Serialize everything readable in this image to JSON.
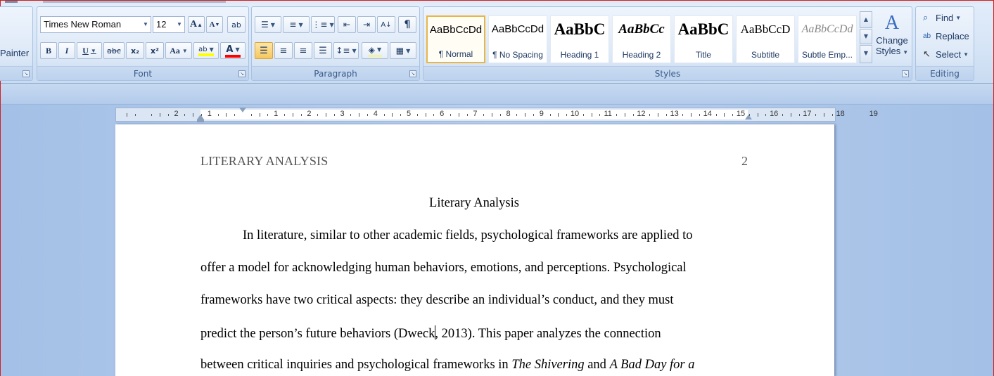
{
  "clipboard": {
    "painter_label": "Painter"
  },
  "font": {
    "group_label": "Font",
    "face": "Times New Roman",
    "size": "12",
    "buttons": {
      "grow": "A",
      "shrink": "A",
      "clear": "ab",
      "bold": "B",
      "italic": "I",
      "underline": "U",
      "strike": "abc",
      "subscript": "x₂",
      "superscript": "x²",
      "case": "Aa",
      "highlight": "ab",
      "font_color": "A"
    },
    "colors": {
      "highlight": "#ffff00",
      "font_color": "#ff0000"
    }
  },
  "paragraph": {
    "group_label": "Paragraph"
  },
  "styles": {
    "group_label": "Styles",
    "tiles": [
      {
        "sample": "AaBbCcDd",
        "name": "¶ Normal"
      },
      {
        "sample": "AaBbCcDd",
        "name": "¶ No Spacing"
      },
      {
        "sample": "AaBbC",
        "name": "Heading 1"
      },
      {
        "sample": "AaBbCc",
        "name": "Heading 2"
      },
      {
        "sample": "AaBbC",
        "name": "Title"
      },
      {
        "sample": "AaBbCcD",
        "name": "Subtitle"
      },
      {
        "sample": "AaBbCcDd",
        "name": "Subtle Emp..."
      }
    ],
    "change_styles_line1": "Change",
    "change_styles_line2": "Styles"
  },
  "editing": {
    "group_label": "Editing",
    "find": "Find",
    "replace": "Replace",
    "select": "Select"
  },
  "ruler": {
    "numbers": [
      "2",
      "1",
      "1",
      "2",
      "3",
      "4",
      "5",
      "6",
      "7",
      "8",
      "9",
      "10",
      "11",
      "12",
      "13",
      "14",
      "15",
      "16",
      "17",
      "18",
      "19"
    ]
  },
  "document": {
    "running_head": "LITERARY ANALYSIS",
    "page_number": "2",
    "title": "Literary Analysis",
    "line1": "In literature, similar to other academic fields, psychological frameworks are applied to",
    "line2": "offer a model for acknowledging human behaviors, emotions, and perceptions. Psychological",
    "line3": "frameworks have two critical aspects: they describe an individual’s conduct, and they must",
    "line4a": "predict the person’s future behaviors (Dweck",
    "line4b": ", 2013). This paper analyzes the connection",
    "line5a": "between critical inquiries and psychological frameworks in ",
    "line5b": "The Shivering",
    "line5c": " and ",
    "line5d": "A Bad Day for a"
  }
}
